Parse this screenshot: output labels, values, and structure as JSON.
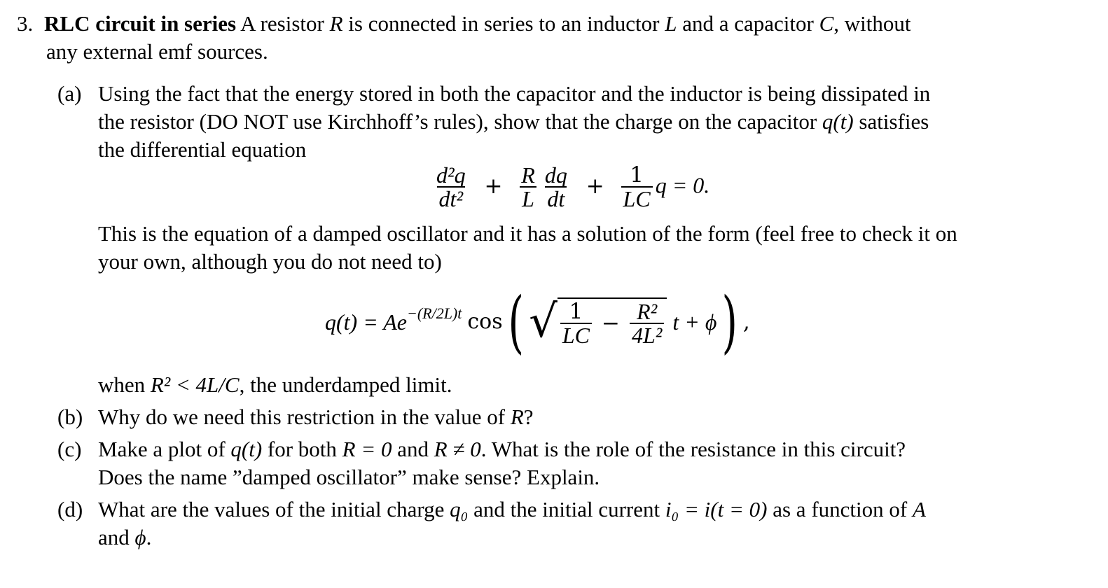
{
  "problem": {
    "number": "3.",
    "title": "RLC circuit in series",
    "intro_1a": "A resistor ",
    "intro_R": "R",
    "intro_1b": " is connected in series to an inductor ",
    "intro_L": "L",
    "intro_1c": " and a capacitor ",
    "intro_C": "C",
    "intro_1d": ", without",
    "intro_2": "any external emf sources."
  },
  "part_a": {
    "label": "(a)",
    "line_1": "Using the fact that the energy stored in both the capacitor and the inductor is being dissipated in",
    "line_2a": "the resistor (DO NOT use Kirchhoff’s rules), show that the charge on the capacitor ",
    "line_2_math": "q(t)",
    "line_2b": " satisfies",
    "line_3": "the differential equation",
    "equation_1": {
      "t1_num": "d²q",
      "t1_den": "dt²",
      "plus_1": "+",
      "t2a_num": "R",
      "t2a_den": "L",
      "t2b_num": "dq",
      "t2b_den": "dt",
      "plus_2": "+",
      "t3_num": "1",
      "t3_den": "LC",
      "tail": "q = 0."
    },
    "line_4": "This is the equation of a damped oscillator and it has a solution of the form (feel free to check it on",
    "line_5": "your own, although you do not need to)",
    "equation_2": {
      "lhs": "q(t) = Ae",
      "exponent": "−(R/2L)t",
      "cos": "cos",
      "open_paren": "(",
      "f1_num": "1",
      "f1_den": "LC",
      "minus": "−",
      "f2_num": "R²",
      "f2_den": "4L²",
      "tail": "t + ϕ",
      "close_paren": ")",
      "comma": ","
    },
    "line_6a": "when ",
    "line_6_math": "R² < 4L/C",
    "line_6b": ", the underdamped limit."
  },
  "part_b": {
    "label": "(b)",
    "text_a": "Why do we need this restriction in the value of ",
    "text_R": "R",
    "text_b": "?"
  },
  "part_c": {
    "label": "(c)",
    "text_a": "Make a plot of ",
    "math_1": "q(t)",
    "text_b": " for both ",
    "math_2": "R = 0",
    "text_c": " and ",
    "math_3": "R ≠ 0",
    "text_d": ". What is the role of the resistance in this circuit?",
    "line_2": "Does the name ”damped oscillator” make sense? Explain."
  },
  "part_d": {
    "label": "(d)",
    "text_a": "What are the values of the initial charge ",
    "math_1": "q₀",
    "text_b": " and the initial current ",
    "math_2": "i₀ = i(t = 0)",
    "text_c": " as a function of ",
    "math_3": "A",
    "line_2a": "and ",
    "math_4": "ϕ",
    "line_2b": "."
  }
}
